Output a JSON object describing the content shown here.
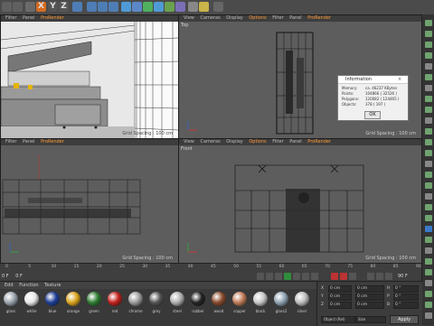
{
  "toolbar": {
    "letters": [
      "X",
      "Y",
      "Z"
    ],
    "icons": [
      "undo-icon",
      "redo-icon",
      "select-icon",
      "move-icon",
      "scale-icon",
      "rotate-icon",
      "model-icon",
      "lock-icon",
      "world-icon",
      "render-region-icon",
      "render-view-icon",
      "render-settings-icon",
      "cube-icon",
      "pen-icon",
      "subdivide-icon",
      "array-icon",
      "deformer-icon",
      "scene-icon",
      "camera-icon",
      "light-icon"
    ],
    "accent": "#ff9a3a"
  },
  "viewports": {
    "perspective": {
      "menu": [
        "Filter",
        "Panel",
        "ProRender"
      ],
      "active": "ProRender",
      "grid_spacing": "Grid Spacing : 100 cm"
    },
    "top": {
      "label": "Top",
      "menu": [
        "View",
        "Cameras",
        "Display",
        "Options",
        "Filter",
        "Panel",
        "ProRender"
      ],
      "grid_spacing": "Grid Spacing : 100 cm"
    },
    "right": {
      "menu": [
        "Filter",
        "Panel",
        "ProRender"
      ],
      "grid_spacing": "Grid Spacing : 100 cm"
    },
    "front": {
      "label": "Front",
      "menu": [
        "View",
        "Cameras",
        "Display",
        "Options",
        "Filter",
        "Panel",
        "ProRender"
      ],
      "grid_spacing": "Grid Spacing : 100 cm"
    }
  },
  "dialog": {
    "title": "Information",
    "rows": [
      {
        "label": "Memory:",
        "value": "ca. 46237 KBytes"
      },
      {
        "label": "Points:",
        "value": "104866 ( 32526 )"
      },
      {
        "label": "Polygons:",
        "value": "120082 ( 124465 )"
      },
      {
        "label": "Objects:",
        "value": "378 ( 197 )"
      }
    ],
    "ok_label": "OK"
  },
  "timeline": {
    "ticks": [
      "0",
      "5",
      "10",
      "15",
      "20",
      "25",
      "30",
      "35",
      "40",
      "45",
      "50",
      "55",
      "60",
      "65",
      "70",
      "75",
      "80",
      "85",
      "90"
    ],
    "start": "0 F",
    "current": "0 F",
    "end": "90 F"
  },
  "materials": {
    "menu": [
      "Edit",
      "Function",
      "Texture"
    ],
    "items": [
      {
        "name": "glass",
        "color": "#9aa4ad"
      },
      {
        "name": "white",
        "color": "#e6e6e6"
      },
      {
        "name": "blue",
        "color": "#1d3e96"
      },
      {
        "name": "orange",
        "color": "#d9a21a"
      },
      {
        "name": "green",
        "color": "#2e7d32"
      },
      {
        "name": "red",
        "color": "#c2201c"
      },
      {
        "name": "chrome",
        "color": "#9c9c9c"
      },
      {
        "name": "grey",
        "color": "#555555"
      },
      {
        "name": "steel",
        "color": "#b0b0b0"
      },
      {
        "name": "rubber",
        "color": "#222222"
      },
      {
        "name": "wood",
        "color": "#8a4a2c"
      },
      {
        "name": "copper",
        "color": "#c07a56"
      },
      {
        "name": "black",
        "color": "#c6c6c6"
      },
      {
        "name": "glass2",
        "color": "#8fa3b3"
      },
      {
        "name": "silver",
        "color": "#bdbdbd"
      }
    ]
  },
  "coords": {
    "axes": [
      "X",
      "Y",
      "Z"
    ],
    "pos": [
      "0 cm",
      "0 cm",
      "0 cm"
    ],
    "size": [
      "0 cm",
      "0 cm",
      "0 cm"
    ],
    "rot": [
      "H",
      "P",
      "B"
    ],
    "rot_vals": [
      "0 °",
      "0 °",
      "0 °"
    ],
    "mode1": "Object (Rel)",
    "mode2": "Size",
    "apply_label": "Apply"
  }
}
